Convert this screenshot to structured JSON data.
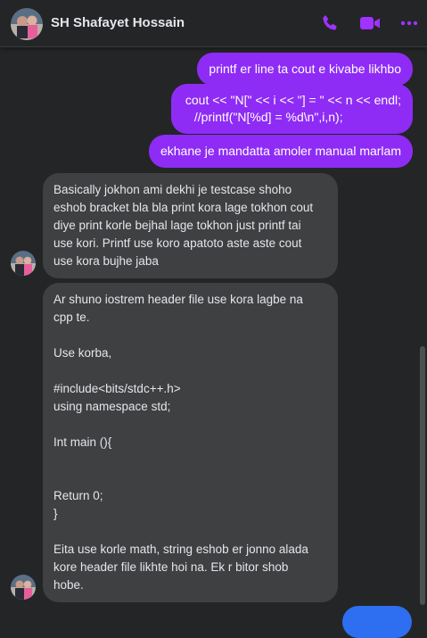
{
  "header": {
    "contact_name": "SH Shafayet Hossain",
    "accent_color": "#a033ff",
    "icons": [
      "phone-icon",
      "video-camera-icon",
      "more-options-icon"
    ]
  },
  "messages": {
    "outgoing": [
      {
        "lines": [
          "printf er line ta cout e kivabe likhbo"
        ]
      },
      {
        "lines": [
          "cout << \"N[\" << i << \"] = \" << n << endl;",
          "//printf(\"N[%d] = %d\\n\",i,n);"
        ]
      },
      {
        "lines": [
          "ekhane je mandatta amoler manual marlam"
        ]
      }
    ],
    "incoming": [
      {
        "lines": [
          "Basically jokhon ami dekhi je testcase shoho",
          "eshob bracket bla bla print kora lage tokhon cout",
          "diye print korle bejhal lage tokhon just printf tai",
          "use kori. Printf use koro apatoto aste aste cout",
          "use kora bujhe jaba"
        ]
      },
      {
        "lines": [
          "Ar shuno iostrem header file use kora lagbe na",
          "cpp te.",
          "",
          "Use korba,",
          "",
          "#include<bits/stdc++.h>",
          "using namespace std;",
          "",
          "Int main (){",
          "",
          "",
          "Return 0;",
          "}",
          "",
          "Eita use korle math, string eshob er jonno alada",
          "kore header file likhte hoi na. Ek r bitor shob",
          "hobe."
        ]
      }
    ]
  },
  "colors": {
    "background": "#242526",
    "outgoing_bubble": "#8e2cf5",
    "incoming_bubble": "#3e4042"
  }
}
